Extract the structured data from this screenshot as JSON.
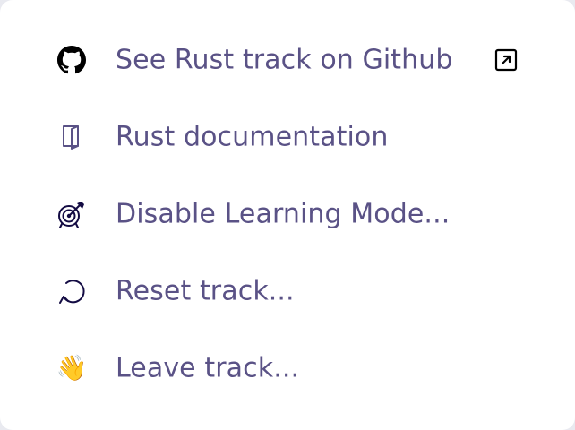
{
  "menu": {
    "items": [
      {
        "label": "See Rust track on Github",
        "icon": "github-icon",
        "external": true,
        "external_icon": "external-link-icon"
      },
      {
        "label": "Rust documentation",
        "icon": "book-icon"
      },
      {
        "label": "Disable Learning Mode...",
        "icon": "target-icon"
      },
      {
        "label": "Reset track...",
        "icon": "reset-icon"
      },
      {
        "label": "Leave track...",
        "icon": "waving-hand-icon",
        "emoji": "👋"
      }
    ],
    "colors": {
      "label": "#5a5286",
      "icon": "#130b43",
      "background": "#ffffff"
    }
  }
}
